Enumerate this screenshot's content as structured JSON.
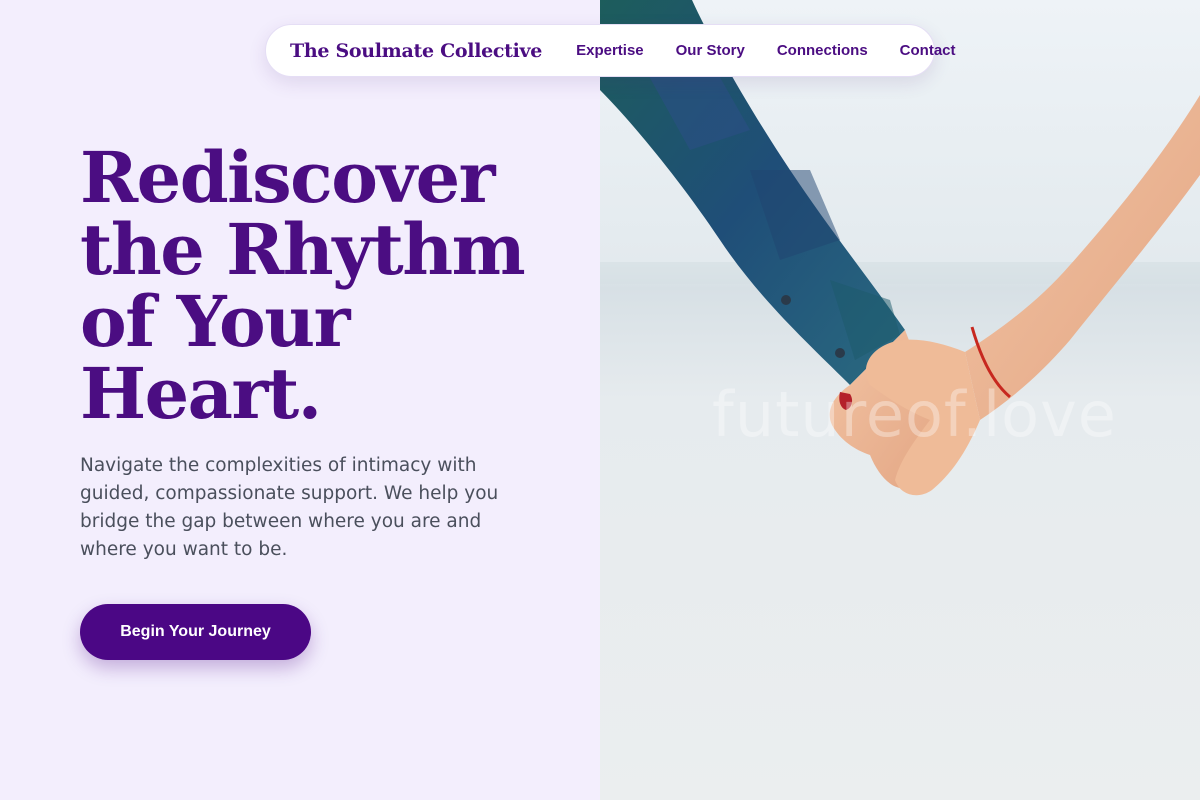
{
  "brand": {
    "name": "The Soulmate Collective"
  },
  "nav": {
    "links": [
      "Expertise",
      "Our Story",
      "Connections",
      "Contact"
    ]
  },
  "hero": {
    "title_lines": [
      "Rediscover",
      "the Rhythm",
      "of Your",
      "Heart."
    ],
    "subtitle": "Navigate the complexities of intimacy with guided, compassionate support. We help you bridge the gap between where you are and where you want to be.",
    "cta_label": "Begin Your Journey"
  },
  "image": {
    "watermark": "futureof.love",
    "alt": "Two people holding hands by the sea"
  },
  "colors": {
    "accent": "#4b0d82",
    "background": "#f3eefd",
    "button": "#4b0785",
    "body_text": "#4a4f5c"
  }
}
